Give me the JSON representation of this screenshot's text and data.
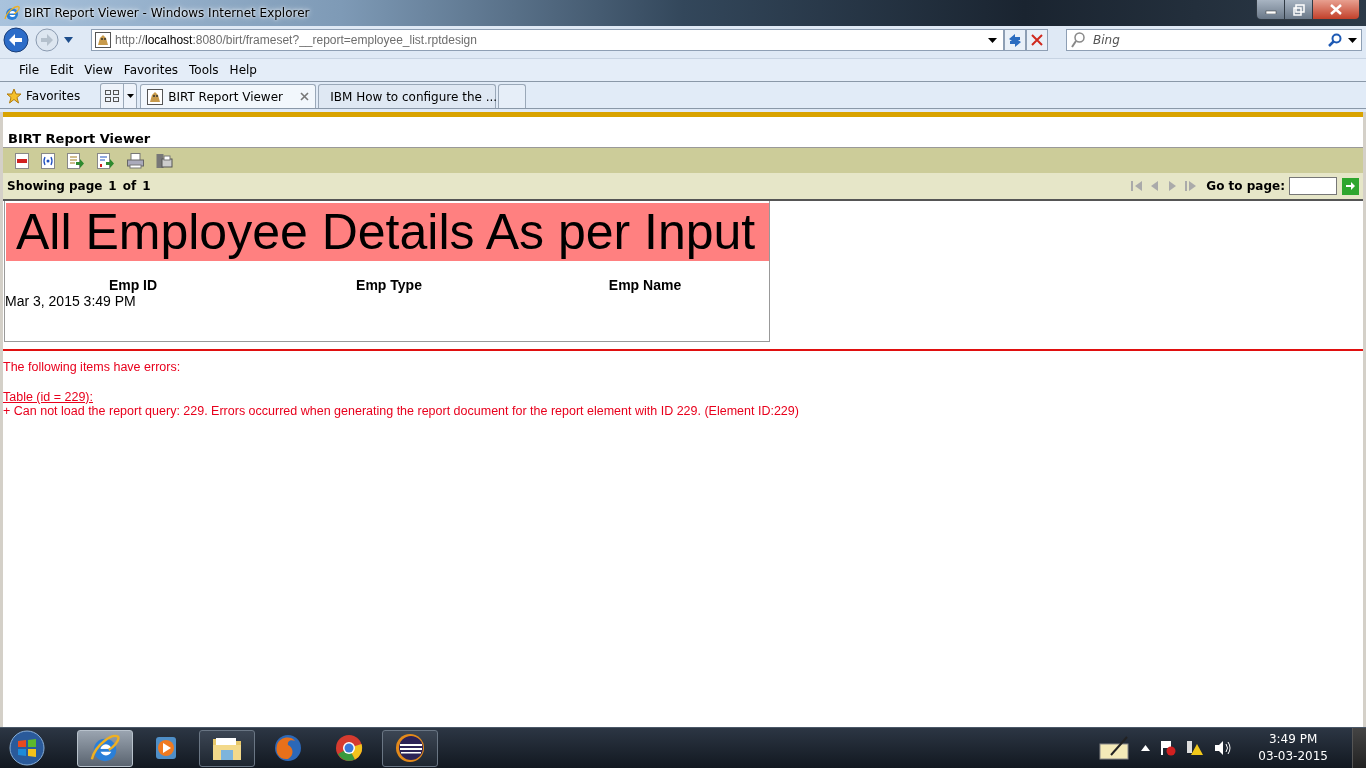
{
  "window": {
    "title": "BIRT Report Viewer - Windows Internet Explorer"
  },
  "address": {
    "url": "http://**localhost**:8080/birt/frameset?__report=employee_list.rptdesign"
  },
  "search": {
    "placeholder": "Bing"
  },
  "menu": [
    "File",
    "Edit",
    "View",
    "Favorites",
    "Tools",
    "Help"
  ],
  "favorites": {
    "label": "Favorites"
  },
  "tabs": [
    {
      "label": "BIRT Report Viewer",
      "kind": "birt",
      "selected": true
    },
    {
      "label": "IBM How to configure the ...",
      "kind": "ie",
      "selected": false
    }
  ],
  "viewer": {
    "title": "BIRT Report Viewer",
    "status": {
      "prefix": "Showing page",
      "current": "1",
      "of": "of",
      "total": "1"
    },
    "goto_label": "Go to page:"
  },
  "report": {
    "heading": "All Employee Details As per Input",
    "columns": [
      "Emp ID",
      "Emp Type",
      "Emp Name"
    ],
    "timestamp": "Mar 3, 2015 3:49 PM"
  },
  "errors": {
    "intro": "The following items have errors:",
    "item": "Table (id = 229):",
    "message": "+ Can not load the report query: 229. Errors occurred when generating the report document for the report element with ID 229. (Element ID:229)"
  },
  "taskbar": {
    "apps": [
      {
        "kind": "ie",
        "running": true,
        "selected": true
      },
      {
        "kind": "media",
        "running": false,
        "selected": false
      },
      {
        "kind": "folder",
        "running": true,
        "selected": false
      },
      {
        "kind": "firefox",
        "running": false,
        "selected": false
      },
      {
        "kind": "chrome",
        "running": false,
        "selected": false
      },
      {
        "kind": "eclipse",
        "running": true,
        "selected": false
      }
    ],
    "time": "3:49 PM",
    "date": "03-03-2015"
  }
}
